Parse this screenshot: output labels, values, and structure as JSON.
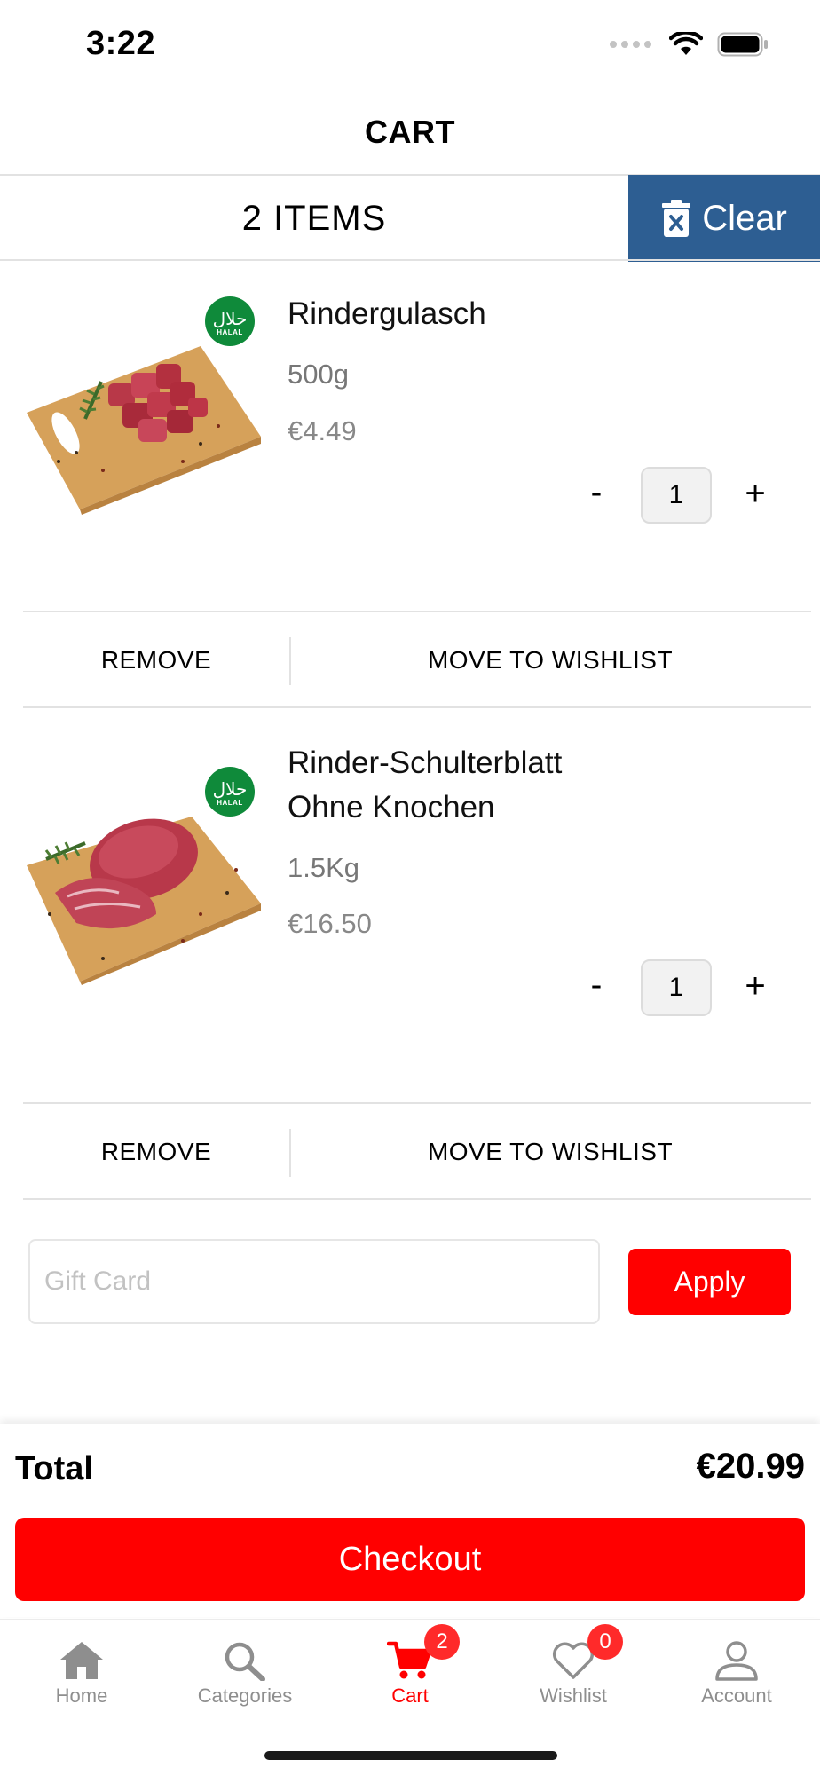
{
  "status_bar": {
    "time": "3:22"
  },
  "nav": {
    "title": "CART"
  },
  "cart_header": {
    "items_count": "2 ITEMS",
    "clear_label": "Clear",
    "clear_color": "#2d5e92"
  },
  "items": [
    {
      "name": "Rindergulasch",
      "size": "500g",
      "price": "€4.49",
      "quantity": "1",
      "minus": "-",
      "plus": "+",
      "badge": {
        "arabic": "حلال",
        "text": "HALAL"
      },
      "remove_label": "REMOVE",
      "wishlist_label": "MOVE TO WISHLIST"
    },
    {
      "name": "Rinder-Schulterblatt Ohne Knochen",
      "size": "1.5Kg",
      "price": "€16.50",
      "quantity": "1",
      "minus": "-",
      "plus": "+",
      "badge": {
        "arabic": "حلال",
        "text": "HALAL"
      },
      "remove_label": "REMOVE",
      "wishlist_label": "MOVE TO WISHLIST"
    }
  ],
  "gift_card": {
    "placeholder": "Gift Card",
    "apply_label": "Apply"
  },
  "summary": {
    "total_label": "Total",
    "total_value": "€20.99",
    "checkout_label": "Checkout"
  },
  "tabs": [
    {
      "label": "Home",
      "icon": "home-icon",
      "active": false
    },
    {
      "label": "Categories",
      "icon": "search-icon",
      "active": false
    },
    {
      "label": "Cart",
      "icon": "cart-icon",
      "active": true,
      "badge": "2"
    },
    {
      "label": "Wishlist",
      "icon": "heart-icon",
      "active": false,
      "badge": "0"
    },
    {
      "label": "Account",
      "icon": "user-icon",
      "active": false
    }
  ],
  "colors": {
    "accent": "#ff0000",
    "halal_green": "#0f8a3a",
    "clear_blue": "#2d5e92"
  }
}
